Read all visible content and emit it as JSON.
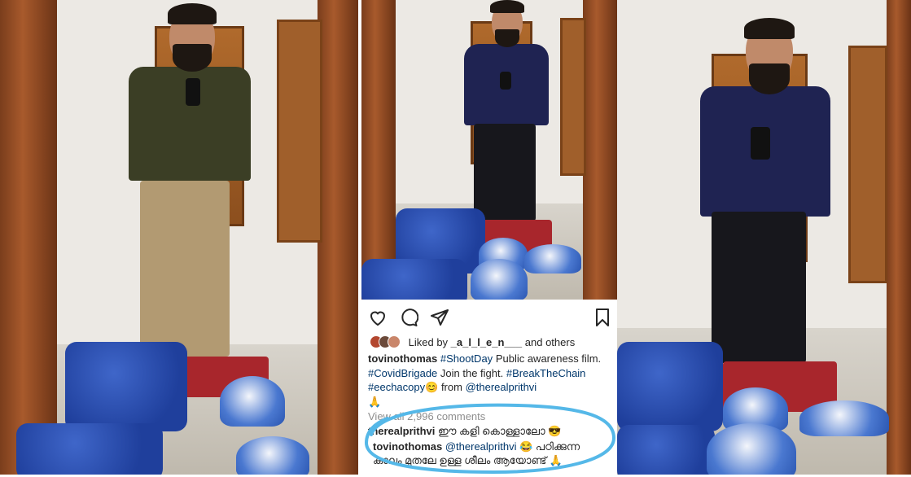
{
  "instagram": {
    "liked_by_prefix": "Liked by",
    "liked_by_user": "_a_l_l_e_n___",
    "liked_by_suffix": "and others",
    "caption_user": "tovinothomas",
    "caption_tag1": "#ShootDay",
    "caption_text1": "Public awareness film.",
    "caption_tag2": "#CovidBrigade",
    "caption_text2": "Join the fight.",
    "caption_tag3": "#BreakTheChain",
    "caption_tag4": "#eechacopy",
    "caption_emoji1": "😊",
    "caption_text3": "from",
    "caption_mention": "@therealprithvi",
    "caption_emoji2": "🙏",
    "view_comments": "View all 2,996 comments",
    "comment1_user": "therealprithvi",
    "comment1_text": "ഈ കളി കൊള്ളാലോ 😎",
    "comment2_user": "tovinothomas",
    "comment2_mention": "@therealprithvi",
    "comment2_text": "😂 പഠിക്കുന്ന കാലം മുതലേ ഉള്ള ശീലം ആയോണ്ട് 🙏",
    "icons": [
      "heart-icon",
      "comment-icon",
      "share-icon",
      "bookmark-icon"
    ],
    "highlight_color": "#55b8e8",
    "link_color": "#00376b"
  }
}
